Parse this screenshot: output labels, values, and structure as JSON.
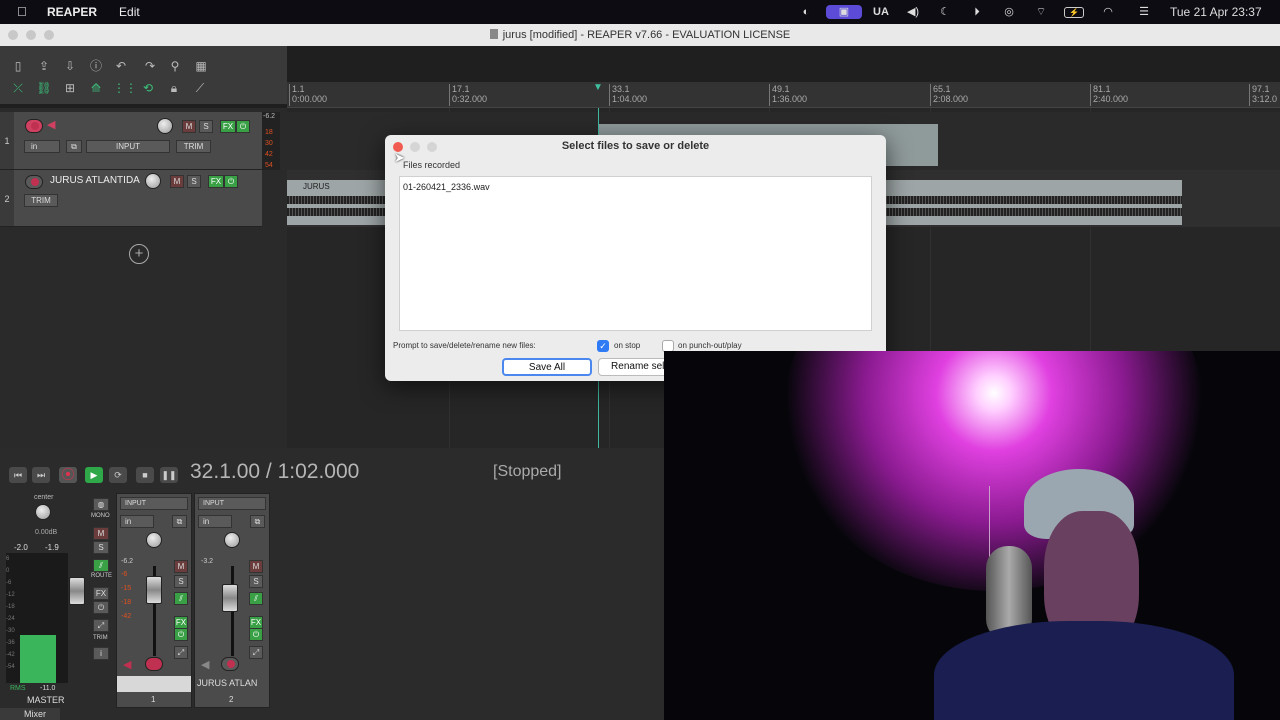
{
  "menubar": {
    "app": "REAPER",
    "edit": "Edit",
    "language": "UA",
    "datetime": "Tue 21 Apr  23:37"
  },
  "window": {
    "title": "jurus [modified] - REAPER v7.66 - EVALUATION LICENSE"
  },
  "ruler": {
    "marks": [
      {
        "bar": "1.1",
        "time": "0:00.000"
      },
      {
        "bar": "17.1",
        "time": "0:32.000"
      },
      {
        "bar": "33.1",
        "time": "1:04.000"
      },
      {
        "bar": "49.1",
        "time": "1:36.000"
      },
      {
        "bar": "65.1",
        "time": "2:08.000"
      },
      {
        "bar": "81.1",
        "time": "2:40.000"
      },
      {
        "bar": "97.1",
        "time": "3:12.0"
      }
    ]
  },
  "tracks": [
    {
      "num": "1",
      "name": "",
      "input": "INPUT",
      "in_label": "in",
      "fx": "FX",
      "trim": "TRIM",
      "mute": "M",
      "solo": "S",
      "meter_values": [
        "-6.2",
        "18",
        "30",
        "42",
        "54"
      ]
    },
    {
      "num": "2",
      "name": "JURUS ATLANTIDA",
      "trim": "TRIM",
      "mute": "M",
      "solo": "S",
      "fx": "FX",
      "item_name": "JURUS"
    }
  ],
  "transport": {
    "position": "32.1.00 / 1:02.000",
    "status": "[Stopped]"
  },
  "mixer": {
    "tab": "Mixer",
    "master": {
      "pan": "center",
      "vol": "0.00dB",
      "peak_l": "-2.0",
      "peak_r": "-1.9",
      "rms_label": "RMS",
      "rms_value": "-11.0",
      "name": "MASTER",
      "mono": "MONO",
      "route": "ROUTE",
      "fx": "FX",
      "trim": "TRIM",
      "mute": "M",
      "solo": "S",
      "info": "i",
      "meter_scale": [
        "6",
        "0",
        "-6",
        "-12",
        "-18",
        "-24",
        "-30",
        "-36",
        "-42",
        "-54"
      ]
    },
    "channels": [
      {
        "num": "1",
        "input": "INPUT",
        "in_label": "in",
        "peak": "-6.2",
        "name": "",
        "mute": "M",
        "solo": "S",
        "fx": "FX",
        "scale": [
          "-6",
          "-15",
          "-18",
          "-42"
        ]
      },
      {
        "num": "2",
        "input": "INPUT",
        "in_label": "in",
        "peak": "-3.2",
        "name": "JURUS ATLAN",
        "mute": "M",
        "solo": "S",
        "fx": "FX"
      }
    ]
  },
  "dialog": {
    "title": "Select files to save or delete",
    "files_label": "Files recorded",
    "files": [
      "01-260421_2336.wav"
    ],
    "prompt_label": "Prompt to save/delete/rename new files:",
    "on_stop_label": "on stop",
    "on_stop_checked": true,
    "on_punch_label": "on punch-out/play",
    "on_punch_checked": false,
    "save_all": "Save All",
    "rename": "Rename selec"
  },
  "colors": {
    "accent_blue": "#2f7bf5",
    "fx_green": "#39a046",
    "rec_red": "#c03050"
  }
}
